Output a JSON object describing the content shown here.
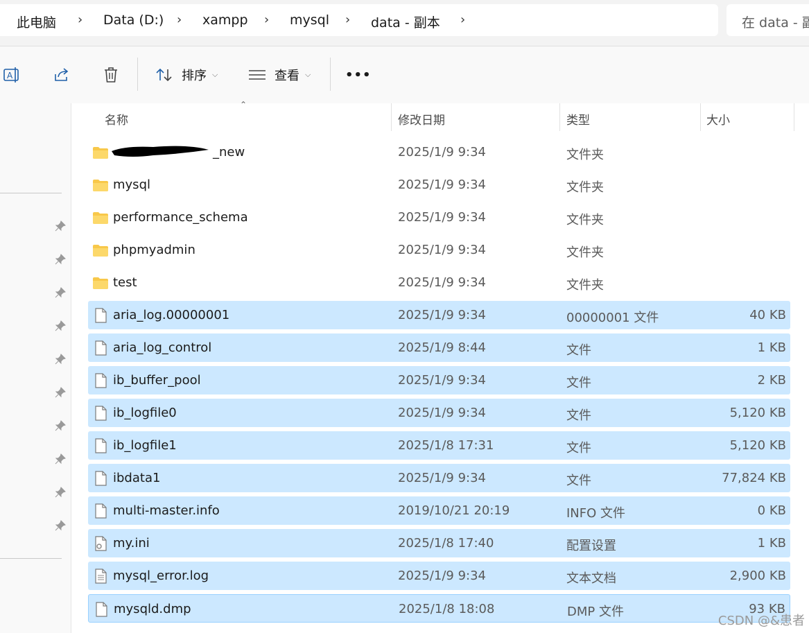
{
  "breadcrumb": [
    "此电脑",
    "Data (D:)",
    "xampp",
    "mysql",
    "data - 副本"
  ],
  "search": {
    "placeholder": "在 data - 副本"
  },
  "toolbar": {
    "sort_label": "排序",
    "view_label": "查看",
    "more_label": "•••"
  },
  "columns": {
    "name": "名称",
    "date": "修改日期",
    "type": "类型",
    "size": "大小"
  },
  "files": [
    {
      "name": "_new",
      "date": "2025/1/9 9:34",
      "type": "文件夹",
      "size": "",
      "icon": "folder-icon",
      "selected": false,
      "redacted": true
    },
    {
      "name": "mysql",
      "date": "2025/1/9 9:34",
      "type": "文件夹",
      "size": "",
      "icon": "folder-icon",
      "selected": false
    },
    {
      "name": "performance_schema",
      "date": "2025/1/9 9:34",
      "type": "文件夹",
      "size": "",
      "icon": "folder-icon",
      "selected": false
    },
    {
      "name": "phpmyadmin",
      "date": "2025/1/9 9:34",
      "type": "文件夹",
      "size": "",
      "icon": "folder-icon",
      "selected": false
    },
    {
      "name": "test",
      "date": "2025/1/9 9:34",
      "type": "文件夹",
      "size": "",
      "icon": "folder-icon",
      "selected": false
    },
    {
      "name": "aria_log.00000001",
      "date": "2025/1/9 9:34",
      "type": "00000001 文件",
      "size": "40 KB",
      "icon": "file-icon",
      "selected": true
    },
    {
      "name": "aria_log_control",
      "date": "2025/1/9 8:44",
      "type": "文件",
      "size": "1 KB",
      "icon": "file-icon",
      "selected": true
    },
    {
      "name": "ib_buffer_pool",
      "date": "2025/1/9 9:34",
      "type": "文件",
      "size": "2 KB",
      "icon": "file-icon",
      "selected": true
    },
    {
      "name": "ib_logfile0",
      "date": "2025/1/9 9:34",
      "type": "文件",
      "size": "5,120 KB",
      "icon": "file-icon",
      "selected": true
    },
    {
      "name": "ib_logfile1",
      "date": "2025/1/8 17:31",
      "type": "文件",
      "size": "5,120 KB",
      "icon": "file-icon",
      "selected": true
    },
    {
      "name": "ibdata1",
      "date": "2025/1/9 9:34",
      "type": "文件",
      "size": "77,824 KB",
      "icon": "file-icon",
      "selected": true
    },
    {
      "name": "multi-master.info",
      "date": "2019/10/21 20:19",
      "type": "INFO 文件",
      "size": "0 KB",
      "icon": "file-icon",
      "selected": true
    },
    {
      "name": "my.ini",
      "date": "2025/1/8 17:40",
      "type": "配置设置",
      "size": "1 KB",
      "icon": "settings-file-icon",
      "selected": true
    },
    {
      "name": "mysql_error.log",
      "date": "2025/1/9 9:34",
      "type": "文本文档",
      "size": "2,900 KB",
      "icon": "text-file-icon",
      "selected": true
    },
    {
      "name": "mysqld.dmp",
      "date": "2025/1/8 18:08",
      "type": "DMP 文件",
      "size": "93 KB",
      "icon": "file-icon",
      "selected": true
    }
  ],
  "watermark": "CSDN @&患者",
  "colors": {
    "selection": "#cce8ff",
    "selection_border": "#99d1ff",
    "folder": "#f8c84a"
  }
}
